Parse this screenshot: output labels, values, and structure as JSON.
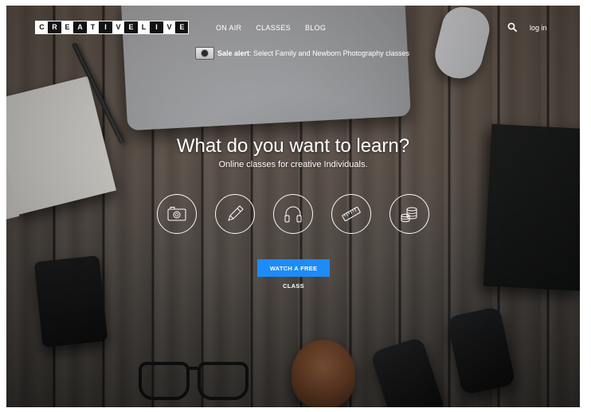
{
  "header": {
    "logo_letters": [
      "C",
      "R",
      "E",
      "A",
      "T",
      "I",
      "V",
      "E",
      "L",
      "I",
      "V",
      "E"
    ],
    "nav": [
      "ON AIR",
      "CLASSES",
      "BLOG"
    ],
    "search_icon": "magnifier-icon",
    "login_label": "log in"
  },
  "sale": {
    "icon": "camera-icon",
    "label": "Sale alert",
    "text": ": Select Family and Newborn Photography classes"
  },
  "hero": {
    "title": "What do you want to learn?",
    "subtitle": "Online classes for creative Individuals."
  },
  "categories": [
    {
      "icon": "camera-icon"
    },
    {
      "icon": "pencil-icon"
    },
    {
      "icon": "headphones-icon"
    },
    {
      "icon": "ruler-icon"
    },
    {
      "icon": "coins-icon"
    }
  ],
  "cta": {
    "label": "WATCH A FREE CLASS",
    "color": "#1d8cf8"
  }
}
